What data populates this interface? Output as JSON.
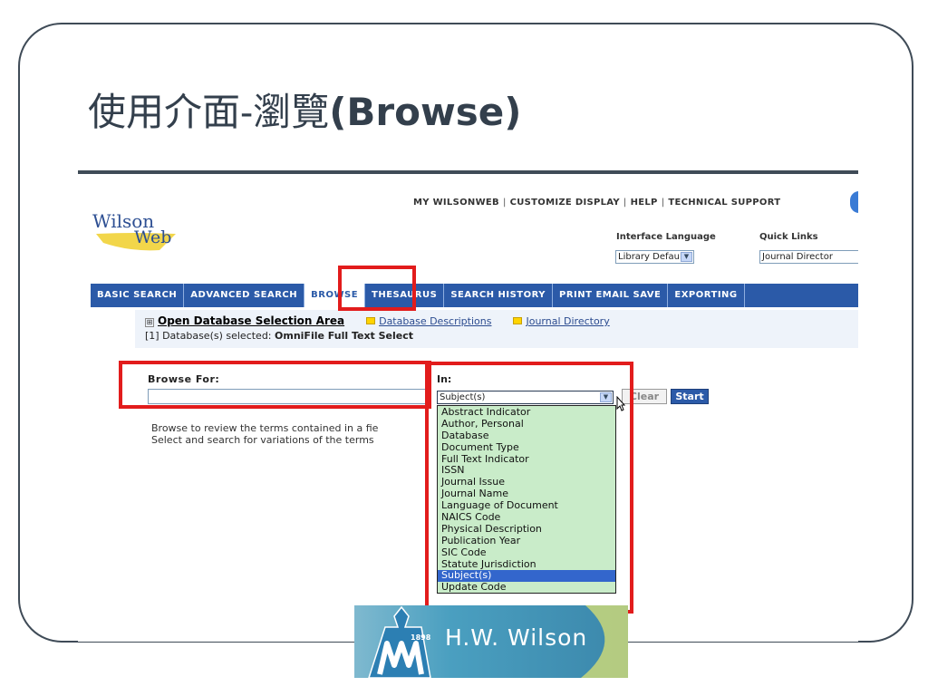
{
  "slide": {
    "title_zh": "使用介面-瀏覽",
    "title_en": "(Browse)"
  },
  "header": {
    "logo_line1": "Wilson",
    "logo_line2": "Web",
    "links": [
      "MY WILSONWEB",
      "CUSTOMIZE DISPLAY",
      "HELP",
      "TECHNICAL SUPPORT"
    ],
    "separator": "|",
    "interface_language_label": "Interface Language",
    "interface_language_value": "Library Default",
    "quick_links_label": "Quick Links",
    "quick_links_value": "Journal Director"
  },
  "nav": {
    "tabs": [
      "BASIC SEARCH",
      "ADVANCED SEARCH",
      "BROWSE",
      "THESAURUS",
      "SEARCH HISTORY",
      "PRINT EMAIL SAVE",
      "EXPORTING"
    ],
    "active": "BROWSE"
  },
  "database_bar": {
    "plus": "⊞",
    "open_link": "Open Database Selection Area",
    "descriptions_link": "Database Descriptions",
    "journal_link": "Journal Directory",
    "selected_prefix": "[1] Database(s) selected:",
    "selected_name": "OmniFile Full Text Select"
  },
  "browse": {
    "browse_for_label": "Browse For:",
    "browse_for_value": "",
    "in_label": "In:",
    "in_value": "Subject(s)",
    "clear_label": "Clear",
    "start_label": "Start",
    "desc_line1": "Browse to review the terms contained in a fie",
    "desc_line2": "Select and search for variations of the terms",
    "options": [
      "Abstract Indicator",
      "Author, Personal",
      "Database",
      "Document Type",
      "Full Text Indicator",
      "ISSN",
      "Journal Issue",
      "Journal Name",
      "Language of Document",
      "NAICS Code",
      "Physical Description",
      "Publication Year",
      "SIC Code",
      "Statute Jurisdiction",
      "Subject(s)",
      "Update Code"
    ],
    "selected_option": "Subject(s)"
  },
  "footer_logo": {
    "year": "1898",
    "name": "H.W. Wilson"
  },
  "colors": {
    "slide_text": "#333f4c",
    "nav_blue": "#2b5aa8",
    "highlight_red": "#e21c1c",
    "dropdown_green": "#c9ecc9",
    "selection_blue": "#3366cc"
  }
}
